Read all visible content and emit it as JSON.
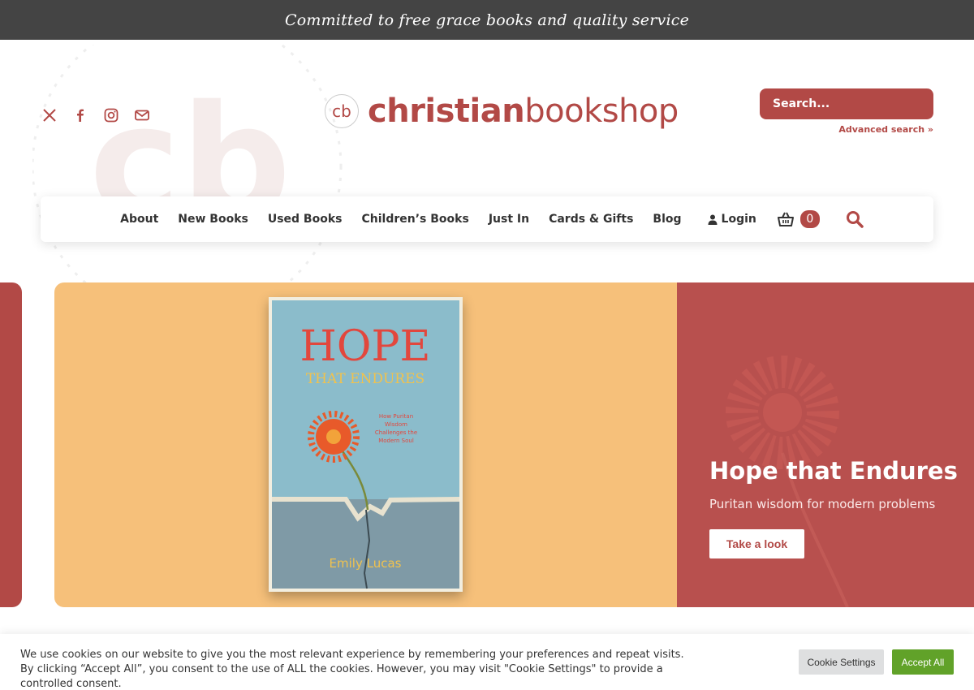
{
  "announcement": "Committed to free grace books and quality service",
  "header": {
    "social": [
      "x-icon",
      "facebook-icon",
      "instagram-icon",
      "mail-icon"
    ],
    "logo": {
      "mark_text": "cb",
      "text_bold": "christian",
      "text_light": "bookshop"
    },
    "search": {
      "placeholder": "Search..."
    },
    "advanced_search": "Advanced search »"
  },
  "nav": {
    "items": [
      "About",
      "New Books",
      "Used Books",
      "Children’s Books",
      "Just In",
      "Cards & Gifts",
      "Blog"
    ],
    "login": "Login",
    "cart_count": "0"
  },
  "hero": {
    "title": "Hope that Endures",
    "subtitle": "Puritan wisdom for modern problems",
    "button": "Take a look",
    "book": {
      "title_line1": "HOPE",
      "title_line2": "THAT ENDURES",
      "tagline": [
        "How Puritan",
        "Wisdom",
        "Challenges the",
        "Modern Soul"
      ],
      "author": "Emily Lucas"
    }
  },
  "cookie": {
    "text": "We use cookies on our website to give you the most relevant experience by remembering your preferences and repeat visits. By clicking “Accept All”, you consent to the use of ALL the cookies. However, you may visit \"Cookie Settings\" to provide a controlled consent.",
    "settings": "Cookie Settings",
    "accept": "Accept All"
  },
  "colors": {
    "brand": "#b24946",
    "topbar": "#444444",
    "slide_left": "#f6c07a",
    "slide_right": "#b8504e",
    "accept_button": "#61a229"
  }
}
